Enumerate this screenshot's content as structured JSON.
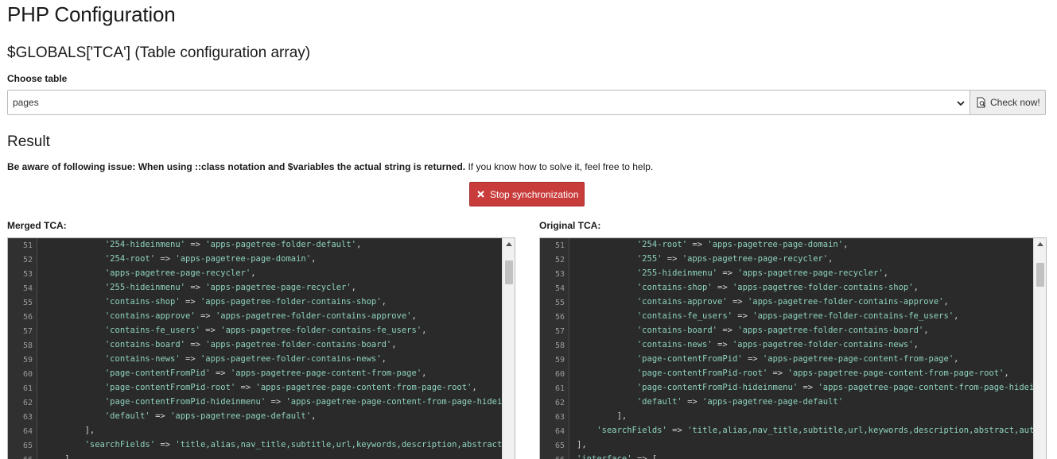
{
  "page": {
    "title": "PHP Configuration",
    "subtitle": "$GLOBALS['TCA'] (Table configuration array)"
  },
  "table_select": {
    "label": "Choose table",
    "value": "pages",
    "check_label": "Check now!"
  },
  "result": {
    "heading": "Result",
    "notice_bold": "Be aware of following issue: When using ::class notation and $variables the actual string is returned.",
    "notice_rest": " If you know how to solve it, feel free to help.",
    "stop_label": "Stop synchronization"
  },
  "merged": {
    "label": "Merged TCA:",
    "lines": [
      {
        "no": "51",
        "indent": "            ",
        "key": "'254-hideinmenu'",
        "op": " => ",
        "val": "'apps-pagetree-folder-default'",
        "tail": ","
      },
      {
        "no": "52",
        "indent": "            ",
        "key": "'254-root'",
        "op": " => ",
        "val": "'apps-pagetree-page-domain'",
        "tail": ","
      },
      {
        "no": "53",
        "indent": "            ",
        "key": "'apps-pagetree-page-recycler'",
        "op": "",
        "val": "",
        "tail": ","
      },
      {
        "no": "54",
        "indent": "            ",
        "key": "'255-hideinmenu'",
        "op": " => ",
        "val": "'apps-pagetree-page-recycler'",
        "tail": ","
      },
      {
        "no": "55",
        "indent": "            ",
        "key": "'contains-shop'",
        "op": " => ",
        "val": "'apps-pagetree-folder-contains-shop'",
        "tail": ","
      },
      {
        "no": "56",
        "indent": "            ",
        "key": "'contains-approve'",
        "op": " => ",
        "val": "'apps-pagetree-folder-contains-approve'",
        "tail": ","
      },
      {
        "no": "57",
        "indent": "            ",
        "key": "'contains-fe_users'",
        "op": " => ",
        "val": "'apps-pagetree-folder-contains-fe_users'",
        "tail": ","
      },
      {
        "no": "58",
        "indent": "            ",
        "key": "'contains-board'",
        "op": " => ",
        "val": "'apps-pagetree-folder-contains-board'",
        "tail": ","
      },
      {
        "no": "59",
        "indent": "            ",
        "key": "'contains-news'",
        "op": " => ",
        "val": "'apps-pagetree-folder-contains-news'",
        "tail": ","
      },
      {
        "no": "60",
        "indent": "            ",
        "key": "'page-contentFromPid'",
        "op": " => ",
        "val": "'apps-pagetree-page-content-from-page'",
        "tail": ","
      },
      {
        "no": "61",
        "indent": "            ",
        "key": "'page-contentFromPid-root'",
        "op": " => ",
        "val": "'apps-pagetree-page-content-from-page-root'",
        "tail": ","
      },
      {
        "no": "62",
        "indent": "            ",
        "key": "'page-contentFromPid-hideinmenu'",
        "op": " => ",
        "val": "'apps-pagetree-page-content-from-page-hideinmenu'",
        "tail": ","
      },
      {
        "no": "63",
        "indent": "            ",
        "key": "'default'",
        "op": " => ",
        "val": "'apps-pagetree-page-default'",
        "tail": ","
      },
      {
        "no": "64",
        "indent": "        ",
        "key": "",
        "op": "",
        "val": "",
        "tail": "],"
      },
      {
        "no": "65",
        "indent": "        ",
        "key": "'searchFields'",
        "op": " => ",
        "val": "'title,alias,nav_title,subtitle,url,keywords,description,abstract,author,author_email'",
        "tail": ","
      },
      {
        "no": "66",
        "indent": "    ",
        "key": "",
        "op": "",
        "val": "",
        "tail": "],"
      }
    ]
  },
  "original": {
    "label": "Original TCA:",
    "lines": [
      {
        "no": "51",
        "indent": "            ",
        "key": "'254-root'",
        "op": " => ",
        "val": "'apps-pagetree-page-domain'",
        "tail": ","
      },
      {
        "no": "52",
        "indent": "            ",
        "key": "'255'",
        "op": " => ",
        "val": "'apps-pagetree-page-recycler'",
        "tail": ","
      },
      {
        "no": "53",
        "indent": "            ",
        "key": "'255-hideinmenu'",
        "op": " => ",
        "val": "'apps-pagetree-page-recycler'",
        "tail": ","
      },
      {
        "no": "54",
        "indent": "            ",
        "key": "'contains-shop'",
        "op": " => ",
        "val": "'apps-pagetree-folder-contains-shop'",
        "tail": ","
      },
      {
        "no": "55",
        "indent": "            ",
        "key": "'contains-approve'",
        "op": " => ",
        "val": "'apps-pagetree-folder-contains-approve'",
        "tail": ","
      },
      {
        "no": "56",
        "indent": "            ",
        "key": "'contains-fe_users'",
        "op": " => ",
        "val": "'apps-pagetree-folder-contains-fe_users'",
        "tail": ","
      },
      {
        "no": "57",
        "indent": "            ",
        "key": "'contains-board'",
        "op": " => ",
        "val": "'apps-pagetree-folder-contains-board'",
        "tail": ","
      },
      {
        "no": "58",
        "indent": "            ",
        "key": "'contains-news'",
        "op": " => ",
        "val": "'apps-pagetree-folder-contains-news'",
        "tail": ","
      },
      {
        "no": "59",
        "indent": "            ",
        "key": "'page-contentFromPid'",
        "op": " => ",
        "val": "'apps-pagetree-page-content-from-page'",
        "tail": ","
      },
      {
        "no": "60",
        "indent": "            ",
        "key": "'page-contentFromPid-root'",
        "op": " => ",
        "val": "'apps-pagetree-page-content-from-page-root'",
        "tail": ","
      },
      {
        "no": "61",
        "indent": "            ",
        "key": "'page-contentFromPid-hideinmenu'",
        "op": " => ",
        "val": "'apps-pagetree-page-content-from-page-hideinmenu'",
        "tail": ","
      },
      {
        "no": "62",
        "indent": "            ",
        "key": "'default'",
        "op": " => ",
        "val": "'apps-pagetree-page-default'",
        "tail": ""
      },
      {
        "no": "63",
        "indent": "        ",
        "key": "",
        "op": "",
        "val": "",
        "tail": "],"
      },
      {
        "no": "64",
        "indent": "    ",
        "key": "'searchFields'",
        "op": " => ",
        "val": "'title,alias,nav_title,subtitle,url,keywords,description,abstract,author,author_email'",
        "tail": ","
      },
      {
        "no": "65",
        "indent": "",
        "key": "",
        "op": "",
        "val": "",
        "tail": "],"
      },
      {
        "no": "66",
        "indent": "",
        "key": "'interface'",
        "op": " => ",
        "val": "",
        "tail": "["
      }
    ]
  },
  "colors": {
    "code_bg": "#2a2a2a",
    "string": "#8fd3c0",
    "danger": "#c83c3c"
  }
}
